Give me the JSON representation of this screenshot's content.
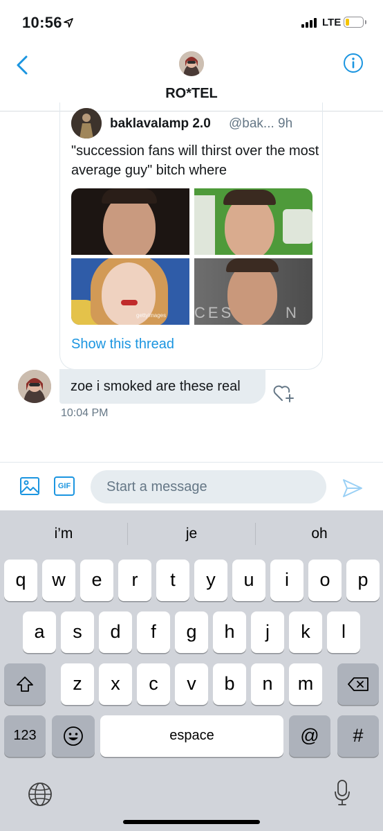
{
  "status_bar": {
    "time": "10:56",
    "network": "LTE",
    "battery_color": "#f5c400"
  },
  "header": {
    "title": "RO*TEL",
    "accent": "#1b95e0"
  },
  "shared_tweet": {
    "name": "baklavalamp 2.0",
    "handle": "@bak...",
    "age": "9h",
    "text": "\"succession fans will thirst over the most average guy\" bitch where",
    "show_thread": "Show this thread",
    "image_watermarks": [
      "gettyimages",
      "CES",
      "N"
    ]
  },
  "message": {
    "text": "zoe i smoked are these real",
    "time": "10:04 PM"
  },
  "composer": {
    "placeholder": "Start a message",
    "gif_label": "GIF"
  },
  "keyboard": {
    "suggestions": [
      "i’m",
      "je",
      "oh"
    ],
    "row1": [
      "q",
      "w",
      "e",
      "r",
      "t",
      "y",
      "u",
      "i",
      "o",
      "p"
    ],
    "row2": [
      "a",
      "s",
      "d",
      "f",
      "g",
      "h",
      "j",
      "k",
      "l"
    ],
    "row3": [
      "z",
      "x",
      "c",
      "v",
      "b",
      "n",
      "m"
    ],
    "numbers_label": "123",
    "space_label": "espace",
    "at_label": "@",
    "hash_label": "#"
  }
}
